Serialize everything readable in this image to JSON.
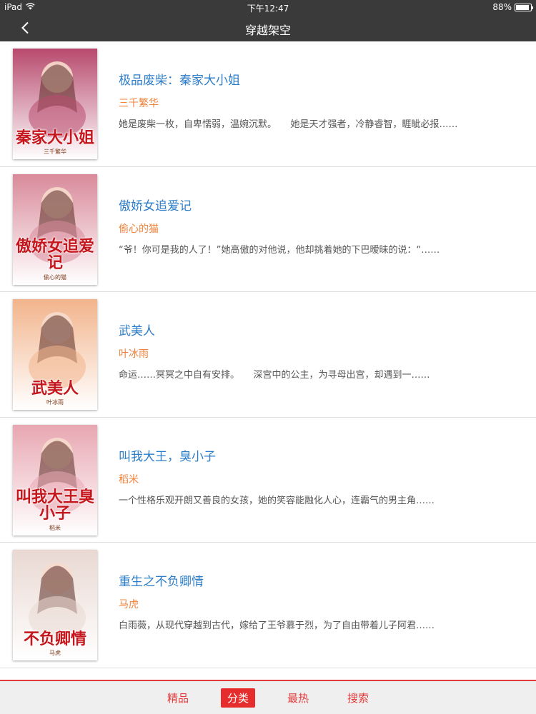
{
  "status": {
    "device": "iPad",
    "time": "下午12:47",
    "battery": "88%",
    "battery_level": 0.88
  },
  "nav": {
    "title": "穿越架空",
    "back_icon": "chevron-left-icon"
  },
  "books": [
    {
      "title": "极品废柴：秦家大小姐",
      "author": "三千繁华",
      "description": "她是废柴一枚，自卑懦弱，温婉沉默。　　她是天才强者，冷静睿智，睚眦必报……",
      "cover_title": "秦家大小姐",
      "cover_author": "三千繁华",
      "cover_color": "#b84a6e"
    },
    {
      "title": "傲娇女追爱记",
      "author": "偷心的猫",
      "description": "“爷！你可是我的人了！”她高傲的对他说，他却挑着她的下巴暧昧的说：“……",
      "cover_title": "傲娇女追爱记",
      "cover_author": "偷心的猫",
      "cover_color": "#d98a9a"
    },
    {
      "title": "武美人",
      "author": "叶冰雨",
      "description": "命运……冥冥之中自有安排。　　深宫中的公主，为寻母出宫，却遇到一……",
      "cover_title": "武美人",
      "cover_author": "叶冰雨",
      "cover_color": "#f2b48c"
    },
    {
      "title": "叫我大王，臭小子",
      "author": "稻米",
      "description": "一个性格乐观开朗又善良的女孩，她的笑容能融化人心，连霸气的男主角……",
      "cover_title": "叫我大王臭小子",
      "cover_author": "稻米",
      "cover_color": "#e8a7b2"
    },
    {
      "title": "重生之不负卿情",
      "author": "马虎",
      "description": "白雨薇，从现代穿越到古代，嫁给了王爷慕于烈，为了自由带着儿子阿君……",
      "cover_title": "不负卿情",
      "cover_author": "马虎",
      "cover_color": "#e9d8d2"
    }
  ],
  "tabs": [
    {
      "label": "精品",
      "active": false
    },
    {
      "label": "分类",
      "active": true
    },
    {
      "label": "最热",
      "active": false
    },
    {
      "label": "搜索",
      "active": false
    }
  ],
  "colors": {
    "nav_bg": "#3a3a3a",
    "title_blue": "#2d7dc8",
    "author_orange": "#f0823a",
    "accent_red": "#e23a3a"
  }
}
